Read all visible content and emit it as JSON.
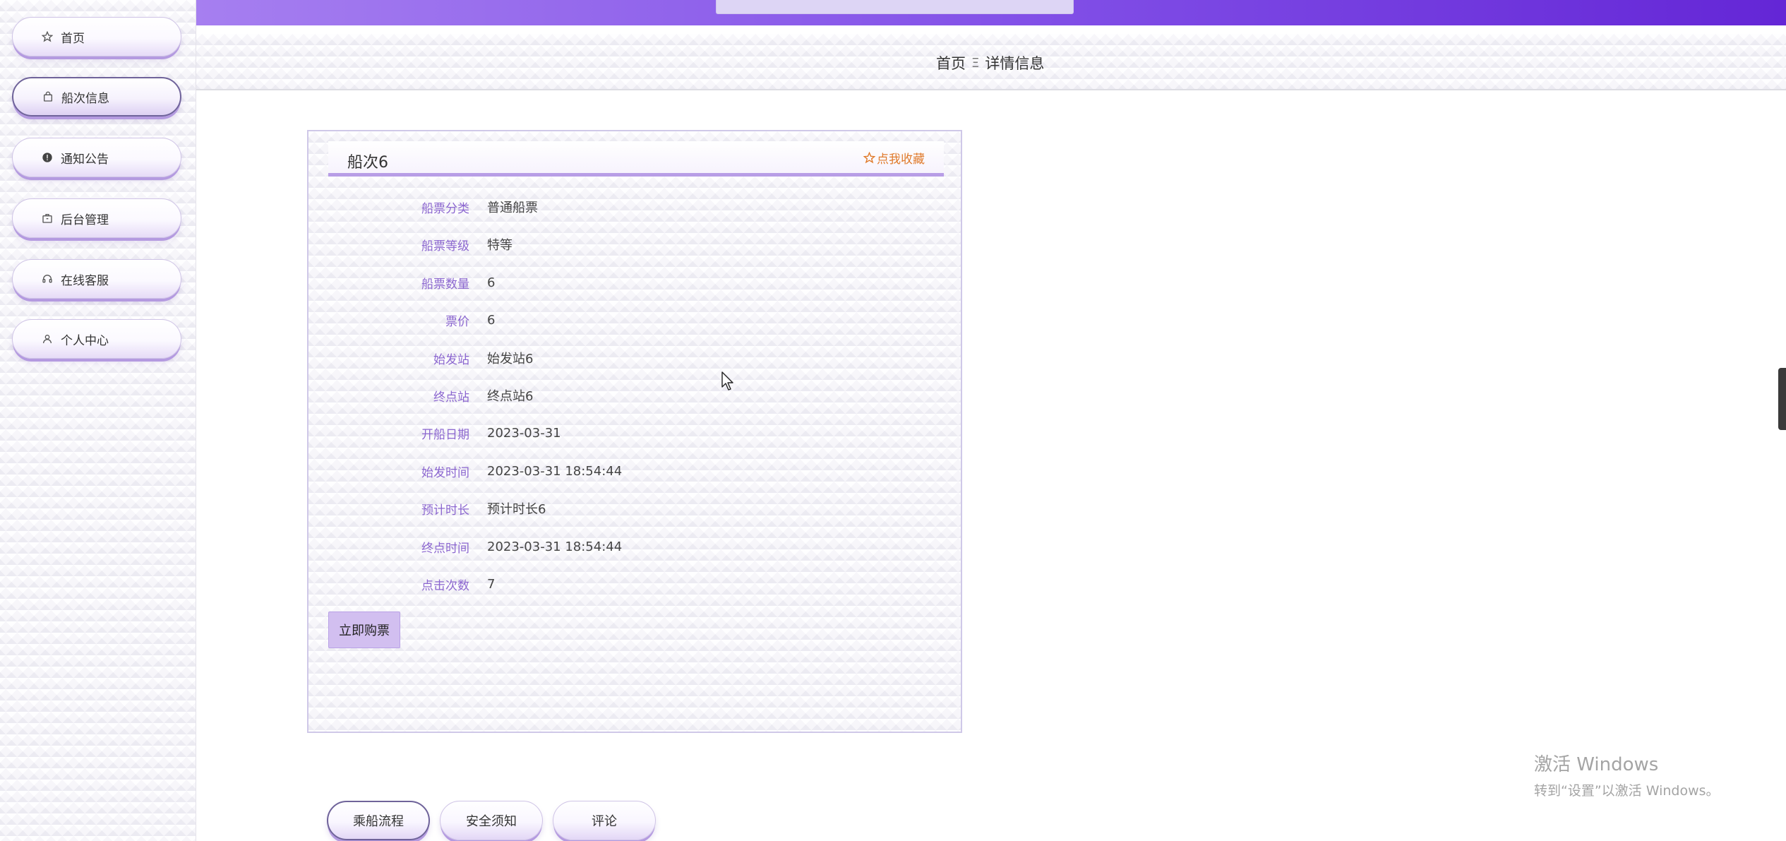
{
  "sidebar": {
    "items": [
      {
        "label": "首页",
        "icon": "star-icon",
        "active": false
      },
      {
        "label": "船次信息",
        "icon": "bag-icon",
        "active": true
      },
      {
        "label": "通知公告",
        "icon": "alert-circle-icon",
        "active": false
      },
      {
        "label": "后台管理",
        "icon": "briefcase-icon",
        "active": false
      },
      {
        "label": "在线客服",
        "icon": "headset-icon",
        "active": false
      },
      {
        "label": "个人中心",
        "icon": "user-icon",
        "active": false
      }
    ]
  },
  "breadcrumb": {
    "home": "首页",
    "separator": "Ξ",
    "current": "详情信息"
  },
  "detail": {
    "title": "船次6",
    "favorite_label": "点我收藏",
    "fields": [
      {
        "label": "船票分类",
        "value": "普通船票"
      },
      {
        "label": "船票等级",
        "value": "特等"
      },
      {
        "label": "船票数量",
        "value": "6"
      },
      {
        "label": "票价",
        "value": "6"
      },
      {
        "label": "始发站",
        "value": "始发站6"
      },
      {
        "label": "终点站",
        "value": "终点站6"
      },
      {
        "label": "开船日期",
        "value": "2023-03-31"
      },
      {
        "label": "始发时间",
        "value": "2023-03-31 18:54:44"
      },
      {
        "label": "预计时长",
        "value": "预计时长6"
      },
      {
        "label": "终点时间",
        "value": "2023-03-31 18:54:44"
      },
      {
        "label": "点击次数",
        "value": "7"
      }
    ],
    "buy_label": "立即购票"
  },
  "tabs": [
    {
      "label": "乘船流程",
      "active": true
    },
    {
      "label": "安全须知",
      "active": false
    },
    {
      "label": "评论",
      "active": false
    }
  ],
  "watermark": {
    "line1": "激活 Windows",
    "line2": "转到“设置”以激活 Windows。"
  },
  "colors": {
    "accent": "#8352e8",
    "label": "#8b66cf",
    "favorite": "#e07b2c",
    "buy_button": "#d2bff0"
  }
}
